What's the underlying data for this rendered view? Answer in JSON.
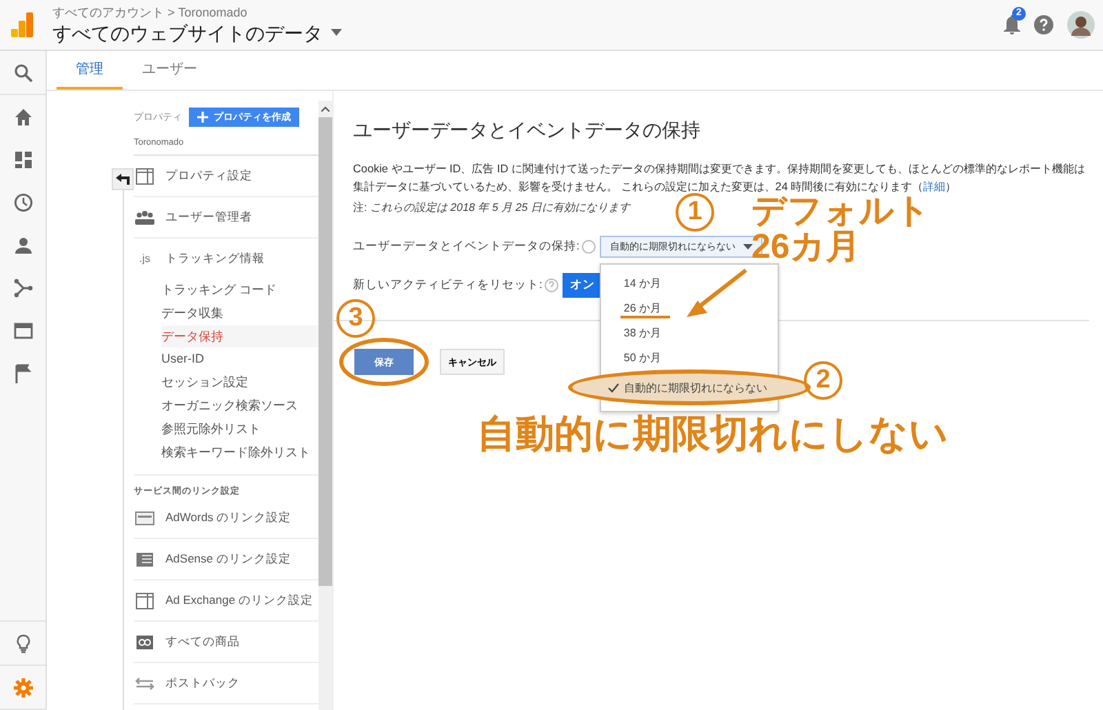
{
  "header": {
    "breadcrumb": "すべてのアカウント > Toronomado",
    "title": "すべてのウェブサイトのデータ",
    "notification_count": "2"
  },
  "rail": [
    {
      "selected": false
    },
    {
      "selected": false
    },
    {
      "selected": false
    },
    {
      "selected": false
    },
    {
      "selected": false
    },
    {
      "selected": false
    },
    {
      "selected": false
    },
    {
      "selected": false
    },
    {
      "selected": false
    },
    {
      "selected": true
    }
  ],
  "tabs": [
    {
      "label": "管理",
      "selected": true
    },
    {
      "label": "ユーザー",
      "selected": false
    }
  ],
  "property_panel": {
    "label": "プロパティ",
    "create_button": "プロパティを作成",
    "account": "Toronomado",
    "items": [
      {
        "kind": "section",
        "label": "プロパティ設定"
      },
      {
        "kind": "section",
        "label": "ユーザー管理者"
      },
      {
        "kind": "section",
        "label": "トラッキング情報",
        "icon_text": ".js",
        "children": [
          {
            "label": "トラッキング コード",
            "selected": false
          },
          {
            "label": "データ収集",
            "selected": false
          },
          {
            "label": "データ保持",
            "selected": true
          },
          {
            "label": "User-ID",
            "selected": false
          },
          {
            "label": "セッション設定",
            "selected": false
          },
          {
            "label": "オーガニック検索ソース",
            "selected": false
          },
          {
            "label": "参照元除外リスト",
            "selected": false
          },
          {
            "label": "検索キーワード除外リスト",
            "selected": false
          }
        ]
      },
      {
        "kind": "heading",
        "label": "サービス間のリンク設定"
      },
      {
        "kind": "section",
        "label": "AdWords のリンク設定"
      },
      {
        "kind": "section",
        "label": "AdSense のリンク設定"
      },
      {
        "kind": "section",
        "label": "Ad Exchange のリンク設定"
      },
      {
        "kind": "section",
        "label": "すべての商品"
      },
      {
        "kind": "section",
        "label": "ポストバック"
      }
    ]
  },
  "content": {
    "title": "ユーザーデータとイベントデータの保持",
    "description": {
      "text": "Cookie やユーザー ID、広告 ID に関連付けて送ったデータの保持期間は変更できます。保持期間を変更しても、ほとんどの標準的なレポート機能は集計データに基づいているため、影響を受けません。 これらの設定に加えた変更は、24 時間後に有効になります（",
      "link": "詳細",
      "after": "）"
    },
    "note": "注: *これらの設定は 2018 年 5 月 25 日に有効になります*",
    "retention_label": "ユーザーデータとイベントデータの保持:",
    "retention_value": "自動的に期限切れにならない",
    "reset_label": "新しいアクティビティをリセット:",
    "reset_button": "オン",
    "save_button": "保存",
    "cancel_button": "キャンセル",
    "dropdown": [
      {
        "label": "14 か月",
        "selected": false
      },
      {
        "label": "26 か月",
        "selected": false
      },
      {
        "label": "38 か月",
        "selected": false
      },
      {
        "label": "50 か月",
        "selected": false
      },
      {
        "label": "自動的に期限切れにならない",
        "selected": true
      }
    ]
  },
  "annotations": {
    "step_1": "1",
    "step_2": "2",
    "step_3": "3",
    "default_note": [
      "デフォルト",
      "26カ月"
    ],
    "caption": "自動的に期限切れにしない"
  }
}
